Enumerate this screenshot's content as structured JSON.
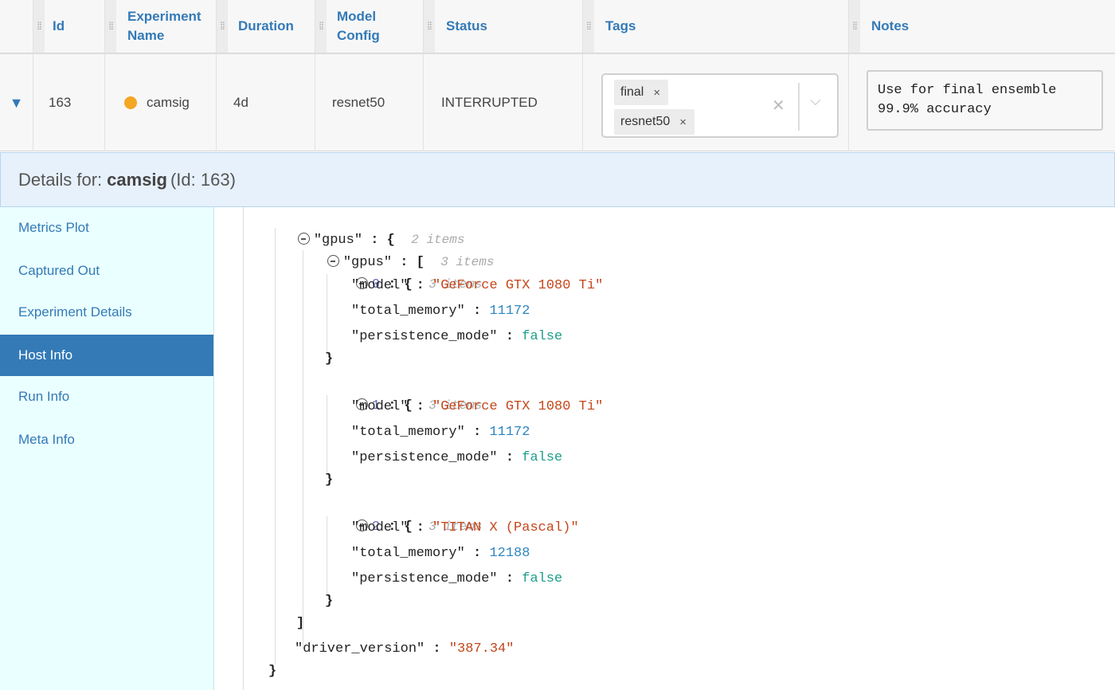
{
  "table": {
    "columns": [
      "Id",
      "Experiment Name",
      "Duration",
      "Model Config",
      "Status",
      "Tags",
      "Notes"
    ],
    "columns_lines": {
      "exp": [
        "Experiment",
        "Name"
      ],
      "model": [
        "Model",
        "Config"
      ]
    },
    "row": {
      "expand_icon": "▼",
      "id": "163",
      "name": "camsig",
      "status_dot_color": "#f5a623",
      "duration": "4d",
      "model_config": "resnet50",
      "status": "INTERRUPTED",
      "tags": [
        "final",
        "resnet50"
      ],
      "tag_remove": "×",
      "tags_clear": "✕",
      "tags_dropdown": "⌵",
      "notes": "Use for final ensemble\n99.9% accuracy"
    }
  },
  "details": {
    "prefix": "Details for:",
    "name": "camsig",
    "suffix": "(Id: 163)"
  },
  "sidebar": {
    "items": [
      "Metrics Plot",
      "Captured Out",
      "Experiment Details",
      "Host Info",
      "Run Info",
      "Meta Info"
    ],
    "active": "Host Info"
  },
  "json_view": {
    "gpus_outer_key": "\"gpus\"",
    "gpus_outer_meta": "2 items",
    "gpus_inner_key": "\"gpus\"",
    "gpus_inner_meta": "3 items",
    "entries": [
      {
        "index": "0",
        "meta": "3 items",
        "model": "\"GeForce GTX 1080 Ti\"",
        "total_memory": "11172",
        "persistence_mode": "false"
      },
      {
        "index": "1",
        "meta": "3 items",
        "model": "\"GeForce GTX 1080 Ti\"",
        "total_memory": "11172",
        "persistence_mode": "false"
      },
      {
        "index": "2",
        "meta": "3 items",
        "model": "\"TITAN X (Pascal)\"",
        "total_memory": "12188",
        "persistence_mode": "false"
      }
    ],
    "key_model": "\"model\"",
    "key_total_memory": "\"total_memory\"",
    "key_persistence_mode": "\"persistence_mode\"",
    "driver_key": "\"driver_version\"",
    "driver_value": "\"387.34\"",
    "colon": " : ",
    "open_brace": "{",
    "close_brace": "}",
    "open_bracket": "[",
    "close_bracket": "]"
  },
  "colors": {
    "accent": "#337ab7",
    "string": "#c4461a",
    "number": "#2e86c1",
    "boolean": "#1d9e8a",
    "sidebar_bg": "#eaffff",
    "details_bg": "#e6f1fb"
  }
}
